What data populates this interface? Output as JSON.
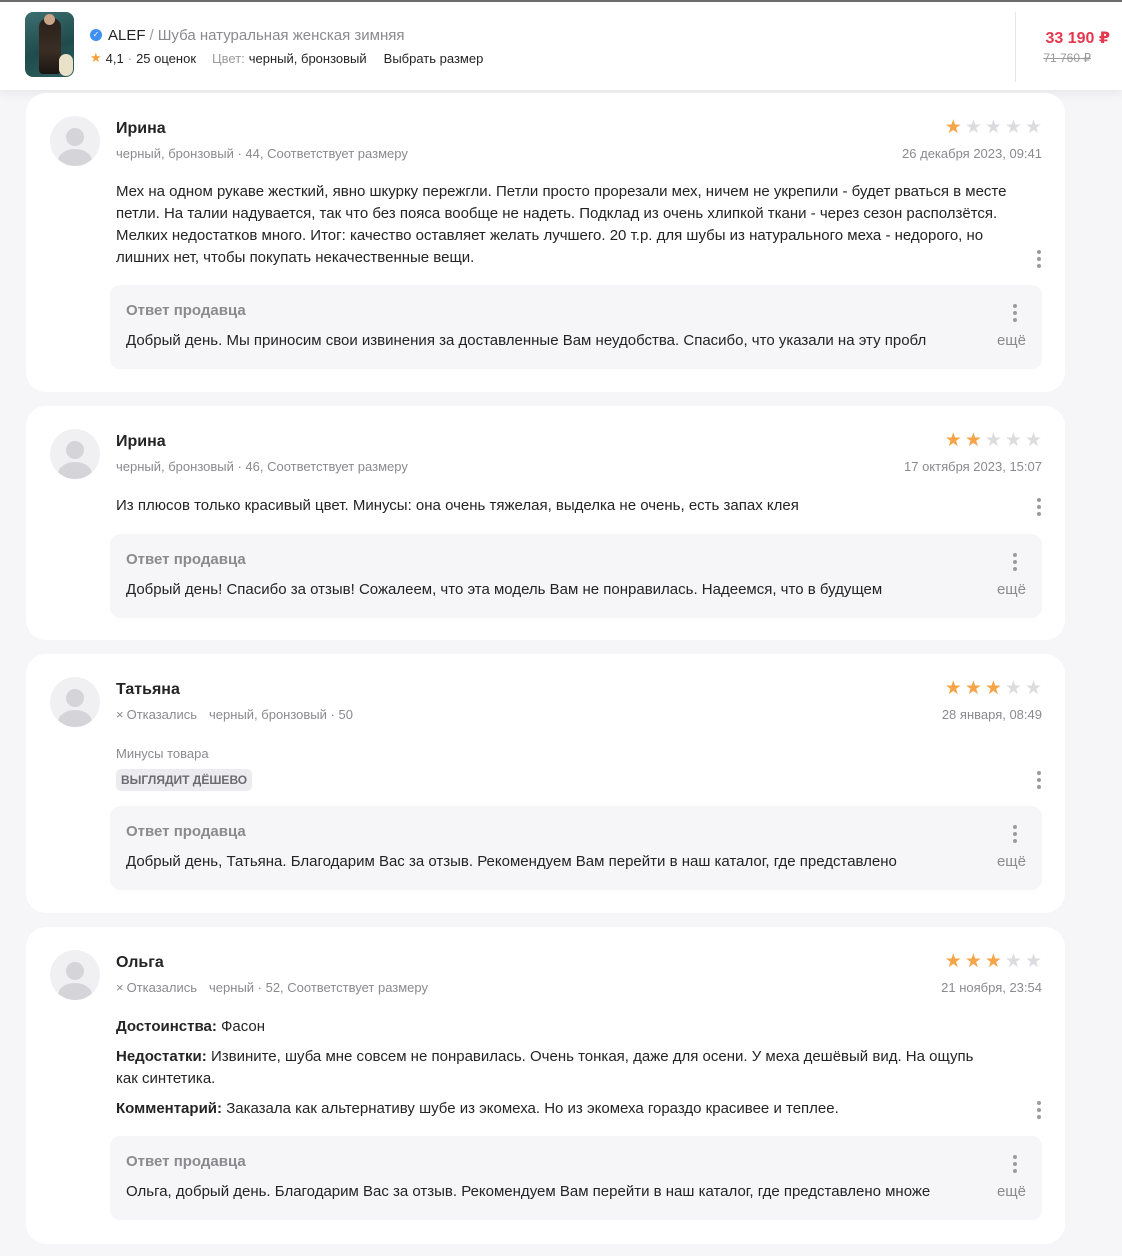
{
  "product": {
    "brand": "ALEF",
    "separator": "/",
    "name": "Шуба натуральная женская зимняя",
    "rating": "4,1",
    "reviews_count": "25 оценок",
    "color_label": "Цвет:",
    "color_value": "черный, бронзовый",
    "size_link": "Выбрать размер",
    "price": "33 190 ₽",
    "old_price": "71 760 ₽"
  },
  "colors": {
    "price_accent": "#e5384f",
    "star_active": "#f5a448",
    "star_inactive": "#dcdce0",
    "verified": "#3f8ff0"
  },
  "seller_reply_title": "Ответ продавца",
  "more_label": "ещё",
  "reviews": [
    {
      "author": "Ирина",
      "meta": "черный, бронзовый · 44, Соответствует размеру",
      "date": "26 декабря 2023, 09:41",
      "rating": 1,
      "text": "Мех на одном рукаве жесткий, явно шкурку пережгли. Петли просто прорезали мех, ничем не укрепили - будет рваться в месте петли. На талии надувается, так что без пояса вообще не надеть. Подклад из очень хлипкой ткани - через сезон расползётся. Мелких недостатков много. Итог: качество оставляет желать лучшего. 20 т.р. для шубы из натурального меха - недорого, но лишних нет, чтобы покупать некачественные вещи.",
      "reply": "Добрый день. Мы приносим свои извинения за доставленные Вам неудобства. Спасибо, что указали на эту пробл"
    },
    {
      "author": "Ирина",
      "meta": "черный, бронзовый · 46, Соответствует размеру",
      "date": "17 октября 2023, 15:07",
      "rating": 2,
      "text": "Из плюсов только красивый цвет. Минусы: она очень тяжелая, выделка не очень, есть запах клея",
      "reply": "Добрый день! Спасибо за отзыв! Сожалеем, что эта модель Вам не понравилась. Надеемся, что в будущем"
    },
    {
      "author": "Татьяна",
      "refused": "Отказались",
      "meta": "черный, бронзовый · 50",
      "date": "28 января, 08:49",
      "rating": 3,
      "minus_label": "Минусы товара",
      "tag": "ВЫГЛЯДИТ ДЁШЕВО",
      "reply": "Добрый день, Татьяна. Благодарим Вас за отзыв. Рекомендуем Вам перейти в наш каталог, где представлено"
    },
    {
      "author": "Ольга",
      "refused": "Отказались",
      "meta": "черный · 52, Соответствует размеру",
      "date": "21 ноября, 23:54",
      "rating": 3,
      "pros_label": "Достоинства:",
      "pros": "Фасон",
      "cons_label": "Недостатки:",
      "cons": "Извините, шуба мне совсем не понравилась. Очень тонкая, даже для осени. У меха дешёвый вид. На ощупь как синтетика.",
      "comment_label": "Комментарий:",
      "comment": "Заказала как альтернативу шубе из экомеха. Но из экомеха гораздо красивее и теплее.",
      "reply": "Ольга, добрый день. Благодарим Вас за отзыв. Рекомендуем Вам перейти в наш каталог, где представлено множе"
    }
  ]
}
